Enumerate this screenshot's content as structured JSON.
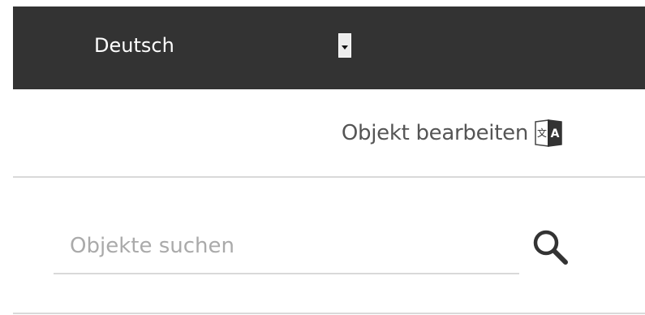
{
  "language_selector": {
    "selected": "Deutsch"
  },
  "toolbar": {
    "edit_object_label": "Objekt bearbeiten",
    "edit_icon": "translate-icon"
  },
  "search": {
    "placeholder": "Objekte suchen",
    "value": "",
    "icon": "search-icon"
  },
  "colors": {
    "header_bg": "#333333",
    "text_dark": "#555555",
    "placeholder": "#aaaaaa",
    "divider": "#d9d9d9"
  }
}
